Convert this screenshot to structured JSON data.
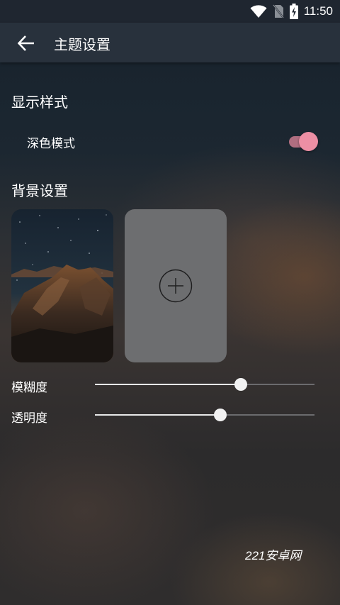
{
  "status_bar": {
    "time": "11:50",
    "icons": [
      "wifi-icon",
      "no-sim-icon",
      "battery-charging-icon"
    ]
  },
  "app_bar": {
    "back_icon": "arrow-left-icon",
    "title": "主题设置"
  },
  "display_section": {
    "title": "显示样式",
    "dark_mode": {
      "label": "深色模式",
      "enabled": true,
      "accent_color": "#ec8fa4"
    }
  },
  "background_section": {
    "title": "背景设置",
    "thumbnail_icon": "mountain-night-sky-image",
    "add_icon": "plus-circle-icon",
    "sliders": {
      "blur": {
        "label": "模糊度",
        "value": 0.665
      },
      "opacity": {
        "label": "透明度",
        "value": 0.57
      }
    }
  },
  "watermark": "221安卓网"
}
